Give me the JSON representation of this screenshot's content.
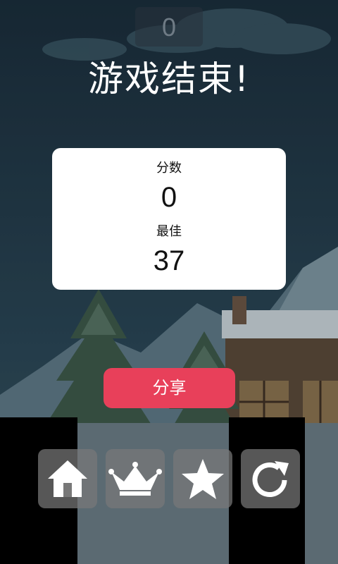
{
  "hud": {
    "current_score": "0"
  },
  "title": "游戏结束!",
  "result_card": {
    "score_label": "分数",
    "score_value": "0",
    "best_label": "最佳",
    "best_value": "37"
  },
  "share_button_label": "分享",
  "toolbar": {
    "buttons": [
      {
        "name": "home",
        "icon": "home-icon"
      },
      {
        "name": "leaderboard",
        "icon": "crown-icon"
      },
      {
        "name": "rate",
        "icon": "star-icon"
      },
      {
        "name": "restart",
        "icon": "restart-icon"
      }
    ]
  },
  "colors": {
    "share_button": "#e8405a",
    "card": "#ffffff",
    "toolbar_button": "#787878"
  }
}
